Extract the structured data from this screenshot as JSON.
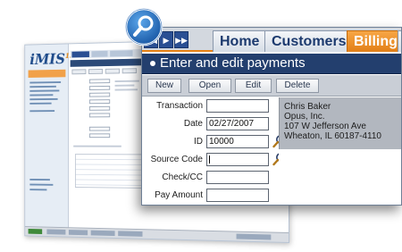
{
  "background_screen": {
    "logo": "iMIS",
    "logo_mark": "15"
  },
  "tabs": {
    "nav_arrows": [
      "◀◀",
      "▶",
      "▶▶"
    ],
    "items": [
      {
        "label": "Home"
      },
      {
        "label": "Customers"
      },
      {
        "label": "Billing",
        "active": true
      }
    ],
    "trailing": "A"
  },
  "page": {
    "title": "Enter and edit payments"
  },
  "toolbar": {
    "new_label": "New",
    "open_label": "Open",
    "edit_label": "Edit",
    "delete_label": "Delete"
  },
  "form": {
    "transaction": {
      "label": "Transaction",
      "value": ""
    },
    "date": {
      "label": "Date",
      "value": "02/27/2007"
    },
    "id": {
      "label": "ID",
      "value": "10000"
    },
    "source_code": {
      "label": "Source Code",
      "value": ""
    },
    "check_cc": {
      "label": "Check/CC",
      "value": ""
    },
    "pay_amount": {
      "label": "Pay Amount",
      "value": ""
    }
  },
  "customer": {
    "name": "Chris Baker",
    "company": "Opus, Inc.",
    "street": "107 W Jefferson Ave",
    "city_state_zip": "Wheaton, IL  60187-4110"
  },
  "colors": {
    "nav_blue": "#2a4f93",
    "title_bar": "#233f6e",
    "active_tab": "#e88214",
    "address_panel": "#b2b7bf"
  },
  "icons": [
    "magnifier-badge-icon",
    "lookup-magnifier-icon",
    "nav-arrow-icon"
  ]
}
